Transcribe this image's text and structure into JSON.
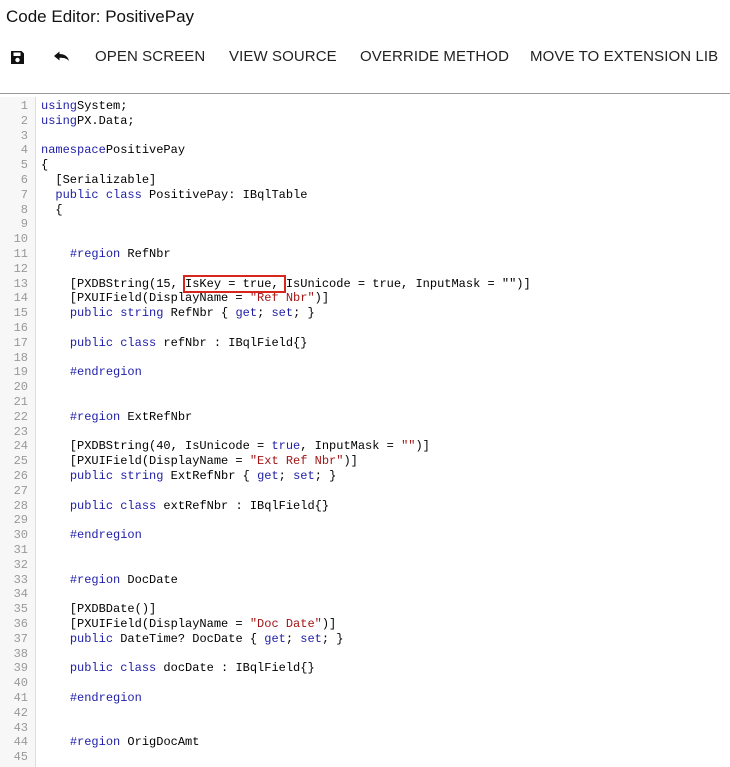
{
  "window": {
    "title": "Code Editor: PositivePay"
  },
  "toolbar": {
    "save_icon": "save-icon",
    "undo_icon": "undo-icon",
    "buttons": [
      "OPEN SCREEN",
      "VIEW SOURCE",
      "OVERRIDE METHOD",
      "MOVE TO EXTENSION LIB"
    ]
  },
  "colors": {
    "keyword": "#1e1ea8",
    "string": "#a31515",
    "highlight": "#d9261c"
  },
  "editor": {
    "lines": [
      [
        [
          "kw",
          "using"
        ],
        [
          "",
          "System;"
        ]
      ],
      [
        [
          "kw",
          "using"
        ],
        [
          "",
          "PX.Data;"
        ]
      ],
      [],
      [
        [
          "kw",
          "namespace"
        ],
        [
          "",
          "PositivePay"
        ]
      ],
      [
        [
          "",
          "{"
        ]
      ],
      [
        [
          "",
          "  [Serializable]"
        ]
      ],
      [
        [
          "",
          "  "
        ],
        [
          "kw",
          "public"
        ],
        [
          "",
          " "
        ],
        [
          "kw",
          "class"
        ],
        [
          "",
          " PositivePay: IBqlTable"
        ]
      ],
      [
        [
          "",
          "  {"
        ]
      ],
      [],
      [],
      [
        [
          "",
          "    "
        ],
        [
          "kw",
          "#region"
        ],
        [
          "",
          " RefNbr"
        ]
      ],
      [],
      [
        [
          "",
          "    [PXDBString(15, IsKey = true, IsUnicode = true, InputMask = \"\")]"
        ]
      ],
      [
        [
          "",
          "    [PXUIField(DisplayName = "
        ],
        [
          "st",
          "\"Ref Nbr\""
        ],
        [
          "",
          ")]"
        ]
      ],
      [
        [
          "",
          "    "
        ],
        [
          "kw",
          "public string"
        ],
        [
          "",
          " RefNbr { "
        ],
        [
          "kw",
          "get"
        ],
        [
          "",
          "; "
        ],
        [
          "kw",
          "set"
        ],
        [
          "",
          "; }"
        ]
      ],
      [],
      [
        [
          "",
          "    "
        ],
        [
          "kw",
          "public class"
        ],
        [
          "",
          " refNbr : IBqlField{}"
        ]
      ],
      [],
      [
        [
          "",
          "    "
        ],
        [
          "kw",
          "#endregion"
        ]
      ],
      [],
      [],
      [
        [
          "",
          "    "
        ],
        [
          "kw",
          "#region"
        ],
        [
          "",
          " ExtRefNbr"
        ]
      ],
      [],
      [
        [
          "",
          "    [PXDBString(40, IsUnicode = "
        ],
        [
          "kw",
          "true"
        ],
        [
          "",
          ", InputMask = "
        ],
        [
          "st",
          "\"\""
        ],
        [
          "",
          ")]"
        ]
      ],
      [
        [
          "",
          "    [PXUIField(DisplayName = "
        ],
        [
          "st",
          "\"Ext Ref Nbr\""
        ],
        [
          "",
          ")]"
        ]
      ],
      [
        [
          "",
          "    "
        ],
        [
          "kw",
          "public string"
        ],
        [
          "",
          " ExtRefNbr { "
        ],
        [
          "kw",
          "get"
        ],
        [
          "",
          "; "
        ],
        [
          "kw",
          "set"
        ],
        [
          "",
          "; }"
        ]
      ],
      [],
      [
        [
          "",
          "    "
        ],
        [
          "kw",
          "public class"
        ],
        [
          "",
          " extRefNbr : IBqlField{}"
        ]
      ],
      [],
      [
        [
          "",
          "    "
        ],
        [
          "kw",
          "#endregion"
        ]
      ],
      [],
      [],
      [
        [
          "",
          "    "
        ],
        [
          "kw",
          "#region"
        ],
        [
          "",
          " DocDate"
        ]
      ],
      [],
      [
        [
          "",
          "    [PXDBDate()]"
        ]
      ],
      [
        [
          "",
          "    [PXUIField(DisplayName = "
        ],
        [
          "st",
          "\"Doc Date\""
        ],
        [
          "",
          ")]"
        ]
      ],
      [
        [
          "",
          "    "
        ],
        [
          "kw",
          "public"
        ],
        [
          "",
          " DateTime? DocDate { "
        ],
        [
          "kw",
          "get"
        ],
        [
          "",
          "; "
        ],
        [
          "kw",
          "set"
        ],
        [
          "",
          "; }"
        ]
      ],
      [],
      [
        [
          "",
          "    "
        ],
        [
          "kw",
          "public class"
        ],
        [
          "",
          " docDate : IBqlField{}"
        ]
      ],
      [],
      [
        [
          "",
          "    "
        ],
        [
          "kw",
          "#endregion"
        ]
      ],
      [],
      [],
      [
        [
          "",
          "    "
        ],
        [
          "kw",
          "#region"
        ],
        [
          "",
          " OrigDocAmt"
        ]
      ],
      []
    ]
  }
}
